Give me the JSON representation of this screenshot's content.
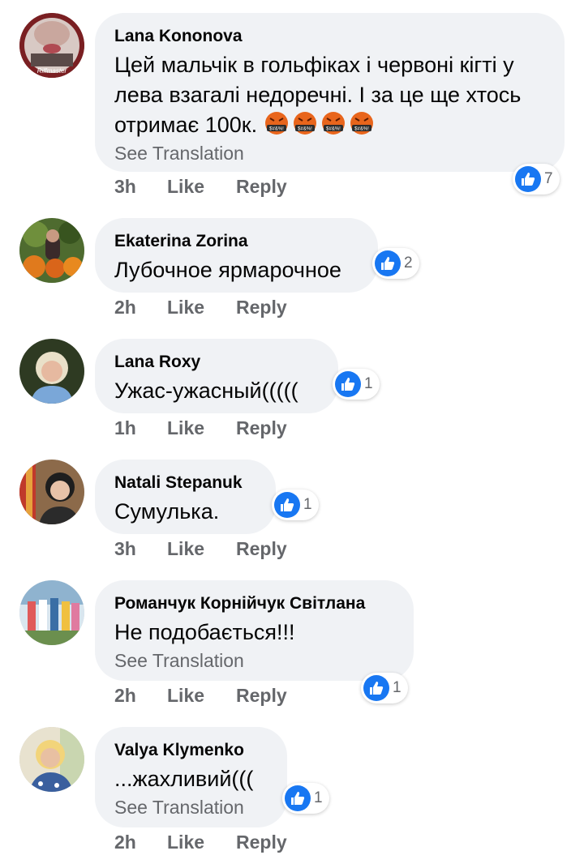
{
  "comments": [
    {
      "author": "Lana  Kononova",
      "text": "Цей мальчік в гольфіках і червоні кігті у лева взагалі недоречні. І за це ще хтось отримає 100к.",
      "see_translation": "See Translation",
      "time": "3h",
      "like": "Like",
      "reply": "Reply",
      "reactions": "7",
      "avatar_overlay": "Riffmaster"
    },
    {
      "author": "Ekaterina Zorina",
      "text": "Лубочное ярмарочное",
      "time": "2h",
      "like": "Like",
      "reply": "Reply",
      "reactions": "2"
    },
    {
      "author": "Lana Roxy",
      "text": "Ужас-ужасный(((((",
      "time": "1h",
      "like": "Like",
      "reply": "Reply",
      "reactions": "1"
    },
    {
      "author": "Natali  Stepanuk",
      "text": "Сумулька.",
      "time": "3h",
      "like": "Like",
      "reply": "Reply",
      "reactions": "1"
    },
    {
      "author": "Романчук Корнійчук Світлана",
      "text": "Не подобається!!!",
      "see_translation": "See Translation",
      "time": "2h",
      "like": "Like",
      "reply": "Reply",
      "reactions": "1"
    },
    {
      "author": "Valya Klymenko",
      "text": "...жахливий(((",
      "see_translation": "See Translation",
      "time": "2h",
      "like": "Like",
      "reply": "Reply",
      "reactions": "1"
    }
  ],
  "icons": {
    "like": "thumbs-up-icon",
    "emoji": "cursing-face-emoji"
  },
  "colors": {
    "bubble": "#f0f2f5",
    "like_blue": "#1877f2",
    "secondary_text": "#65676b",
    "emoji_orange": "#e8651c"
  }
}
